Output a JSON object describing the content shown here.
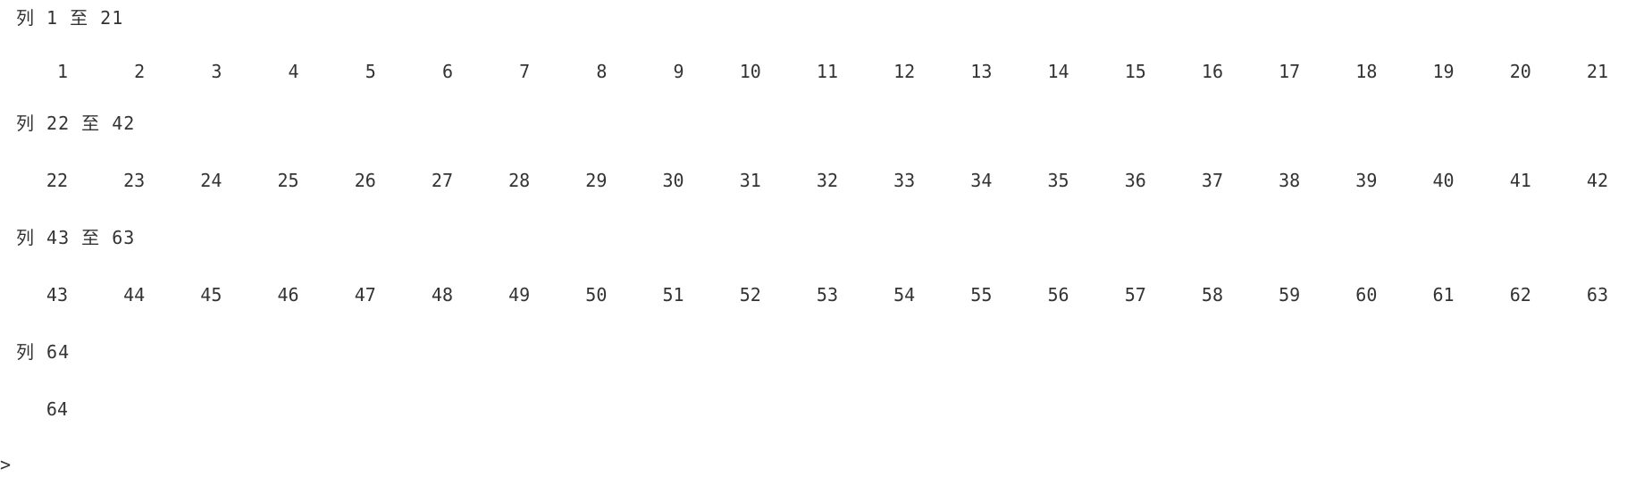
{
  "console": {
    "blocks": [
      {
        "header": "列 1 至 21",
        "values": [
          "1",
          "2",
          "3",
          "4",
          "5",
          "6",
          "7",
          "8",
          "9",
          "10",
          "11",
          "12",
          "13",
          "14",
          "15",
          "16",
          "17",
          "18",
          "19",
          "20",
          "21"
        ]
      },
      {
        "header": "列 22 至 42",
        "values": [
          "22",
          "23",
          "24",
          "25",
          "26",
          "27",
          "28",
          "29",
          "30",
          "31",
          "32",
          "33",
          "34",
          "35",
          "36",
          "37",
          "38",
          "39",
          "40",
          "41",
          "42"
        ]
      },
      {
        "header": "列 43 至 63",
        "values": [
          "43",
          "44",
          "45",
          "46",
          "47",
          "48",
          "49",
          "50",
          "51",
          "52",
          "53",
          "54",
          "55",
          "56",
          "57",
          "58",
          "59",
          "60",
          "61",
          "62",
          "63"
        ]
      },
      {
        "header": "列 64",
        "values": [
          "64"
        ]
      }
    ],
    "prompt": ">"
  }
}
